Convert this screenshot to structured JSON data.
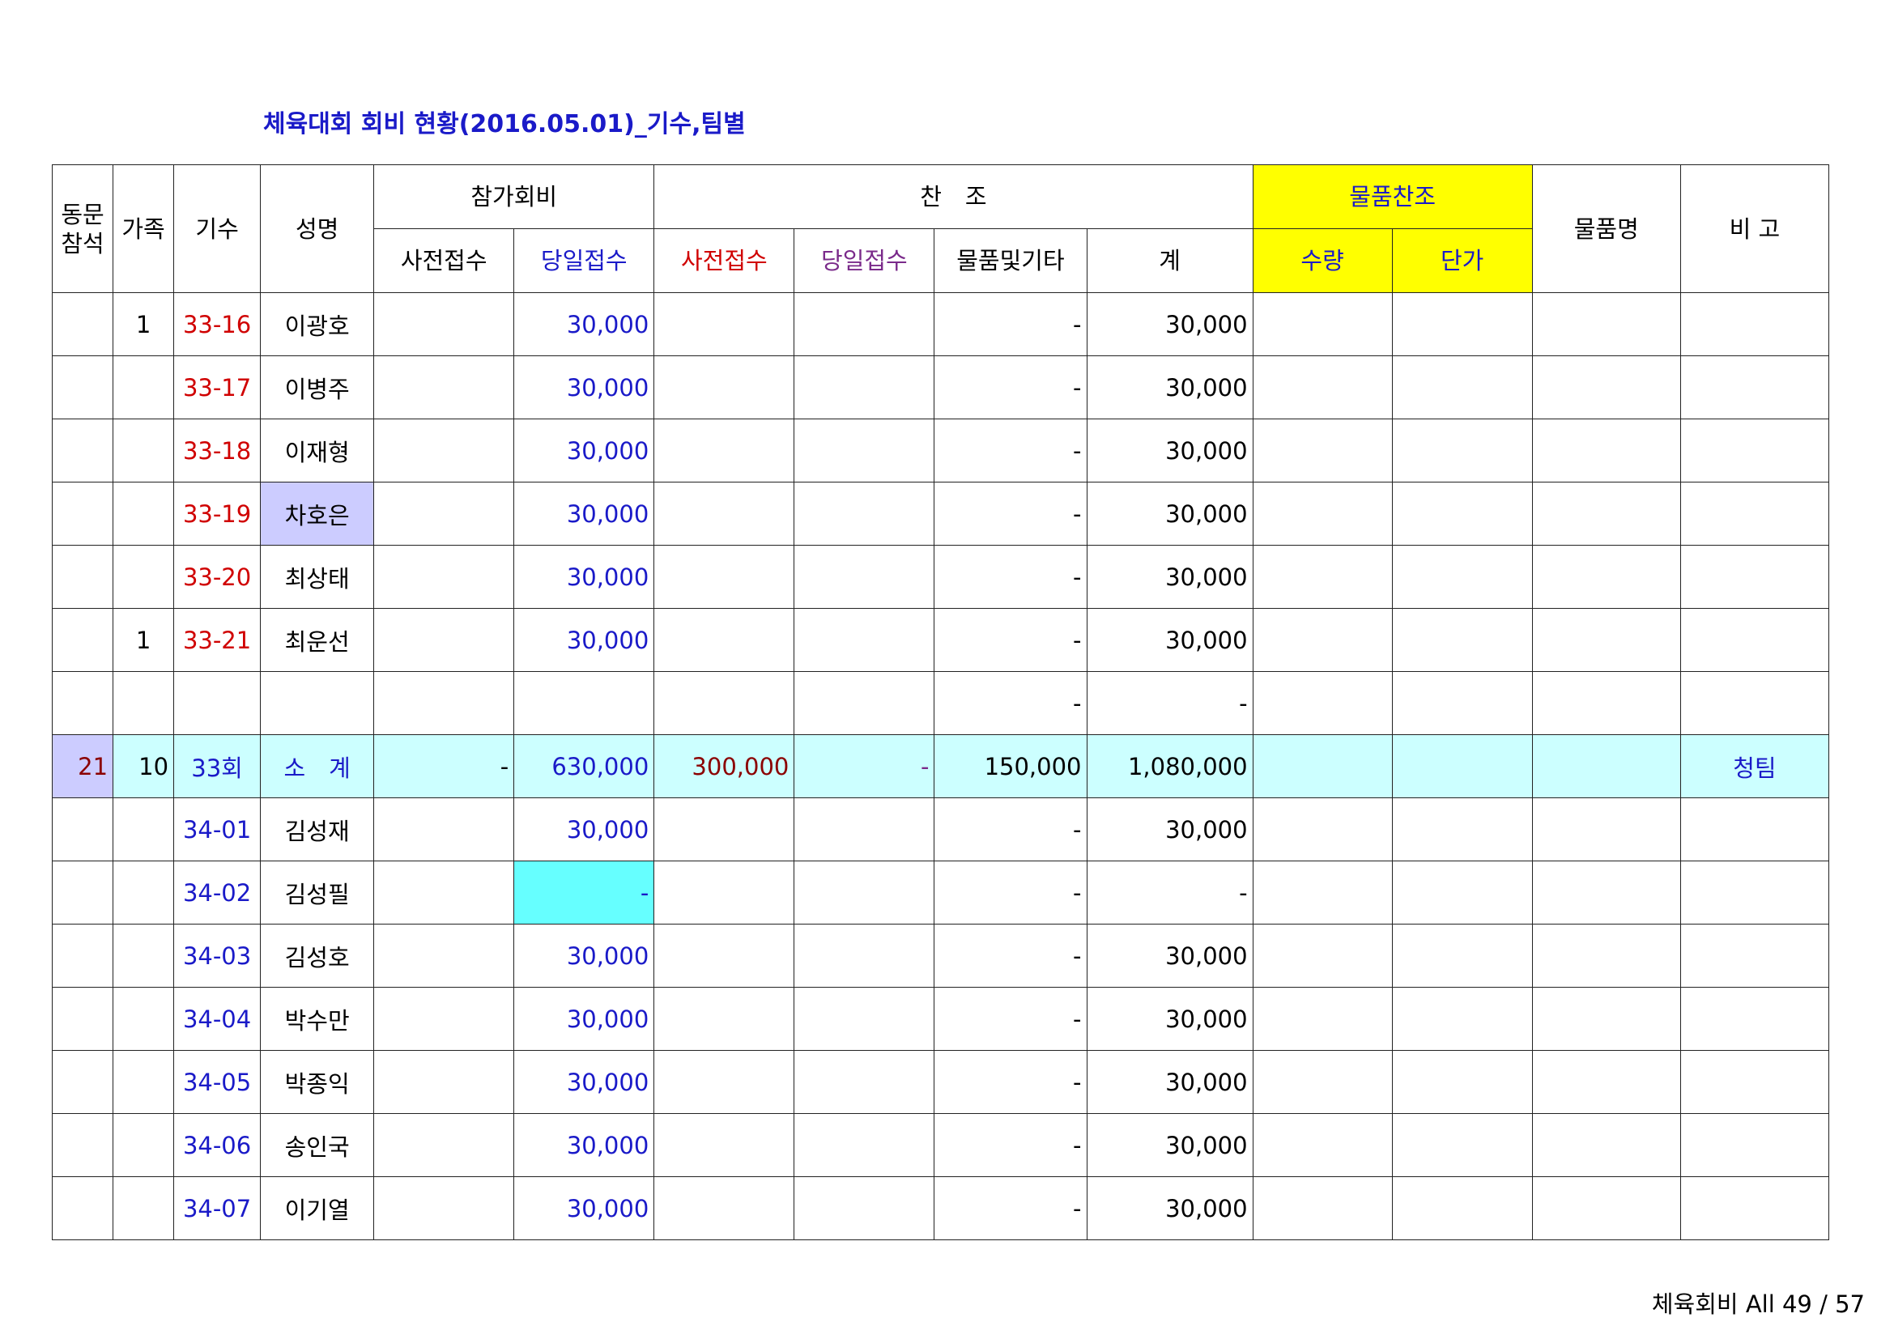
{
  "title": "체육대회 회비 현황(2016.05.01)_기수,팀별",
  "colors": {
    "blue": "#1a1ac8",
    "red": "#d00000",
    "yellow": "#ffff00",
    "subtotal": "#ccffff",
    "lavender": "#ccccff",
    "cyan": "#66ffff"
  },
  "headers": {
    "attend_line1": "동문",
    "attend_line2": "참석",
    "family": "가족",
    "class": "기수",
    "name": "성명",
    "fee_group": "참가회비",
    "fee_pre": "사전접수",
    "fee_day": "당일접수",
    "sponsor_group": "찬　조",
    "sp_pre": "사전접수",
    "sp_day": "당일접수",
    "sp_goods": "물품및기타",
    "sp_total": "계",
    "goods_group": "물품찬조",
    "qty": "수량",
    "price": "단가",
    "goods_name": "물품명",
    "remark": "비 고"
  },
  "rows": [
    {
      "attend": "",
      "family": "1",
      "class": "33-16",
      "name": "이광호",
      "fee_pre": "",
      "fee_day": "30,000",
      "sp_pre": "",
      "sp_day": "",
      "sp_goods": "-",
      "sp_total": "30,000"
    },
    {
      "attend": "",
      "family": "",
      "class": "33-17",
      "name": "이병주",
      "fee_pre": "",
      "fee_day": "30,000",
      "sp_pre": "",
      "sp_day": "",
      "sp_goods": "-",
      "sp_total": "30,000"
    },
    {
      "attend": "",
      "family": "",
      "class": "33-18",
      "name": "이재형",
      "fee_pre": "",
      "fee_day": "30,000",
      "sp_pre": "",
      "sp_day": "",
      "sp_goods": "-",
      "sp_total": "30,000"
    },
    {
      "attend": "",
      "family": "",
      "class": "33-19",
      "name": "차호은",
      "fee_pre": "",
      "fee_day": "30,000",
      "sp_pre": "",
      "sp_day": "",
      "sp_goods": "-",
      "sp_total": "30,000"
    },
    {
      "attend": "",
      "family": "",
      "class": "33-20",
      "name": "최상태",
      "fee_pre": "",
      "fee_day": "30,000",
      "sp_pre": "",
      "sp_day": "",
      "sp_goods": "-",
      "sp_total": "30,000"
    },
    {
      "attend": "",
      "family": "1",
      "class": "33-21",
      "name": "최운선",
      "fee_pre": "",
      "fee_day": "30,000",
      "sp_pre": "",
      "sp_day": "",
      "sp_goods": "-",
      "sp_total": "30,000"
    },
    {
      "attend": "",
      "family": "",
      "class": "",
      "name": "",
      "fee_pre": "",
      "fee_day": "",
      "sp_pre": "",
      "sp_day": "",
      "sp_goods": "-",
      "sp_total": "-"
    }
  ],
  "subtotal": {
    "attend": "21",
    "family": "10",
    "class": "33회",
    "name": "소　계",
    "fee_pre": "-",
    "fee_day": "630,000",
    "sp_pre": "300,000",
    "sp_day": "-",
    "sp_goods": "150,000",
    "sp_total": "1,080,000",
    "remark": "청팀"
  },
  "rows2": [
    {
      "class": "34-01",
      "name": "김성재",
      "fee_day": "30,000",
      "sp_goods": "-",
      "sp_total": "30,000"
    },
    {
      "class": "34-02",
      "name": "김성필",
      "fee_day": "-",
      "sp_goods": "-",
      "sp_total": "-"
    },
    {
      "class": "34-03",
      "name": "김성호",
      "fee_day": "30,000",
      "sp_goods": "-",
      "sp_total": "30,000"
    },
    {
      "class": "34-04",
      "name": "박수만",
      "fee_day": "30,000",
      "sp_goods": "-",
      "sp_total": "30,000"
    },
    {
      "class": "34-05",
      "name": "박종익",
      "fee_day": "30,000",
      "sp_goods": "-",
      "sp_total": "30,000"
    },
    {
      "class": "34-06",
      "name": "송인국",
      "fee_day": "30,000",
      "sp_goods": "-",
      "sp_total": "30,000"
    },
    {
      "class": "34-07",
      "name": "이기열",
      "fee_day": "30,000",
      "sp_goods": "-",
      "sp_total": "30,000"
    }
  ],
  "footer": "체육회비 All 49 / 57"
}
